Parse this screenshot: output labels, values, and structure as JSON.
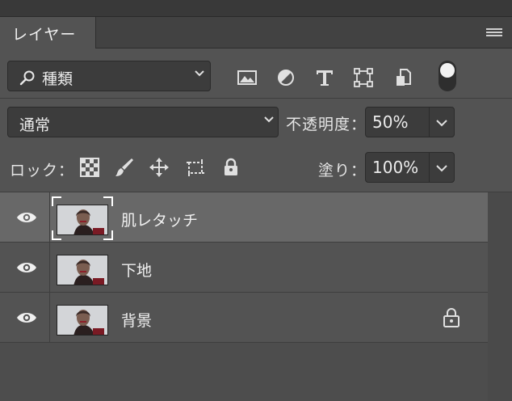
{
  "panel": {
    "tab_label": "レイヤー"
  },
  "filter": {
    "kind_label": "種類",
    "icons": [
      "image-filter-icon",
      "adjustment-filter-icon",
      "type-filter-icon",
      "shape-filter-icon",
      "smart-object-filter-icon",
      "filter-toggle-switch"
    ]
  },
  "blend": {
    "mode": "通常",
    "opacity_label": "不透明度：",
    "opacity_value": "50%"
  },
  "lock": {
    "label": "ロック：",
    "icons": [
      "lock-transparent-pixels-icon",
      "lock-image-pixels-icon",
      "lock-position-icon",
      "lock-artboard-icon",
      "lock-all-icon"
    ],
    "fill_label": "塗り：",
    "fill_value": "100%"
  },
  "layers": [
    {
      "name": "肌レタッチ",
      "visible": true,
      "selected": true,
      "locked": false
    },
    {
      "name": "下地",
      "visible": true,
      "selected": false,
      "locked": false
    },
    {
      "name": "背景",
      "visible": true,
      "selected": false,
      "locked": true
    }
  ],
  "colors": {
    "panel_bg": "#535353",
    "selected_row": "#686868",
    "field_bg": "#3c3c3c",
    "text": "#e6e6e6"
  }
}
